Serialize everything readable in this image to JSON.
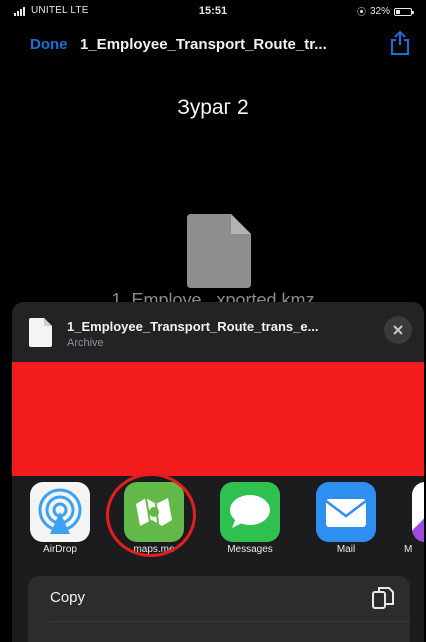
{
  "status_bar": {
    "carrier": "UNITEL  LTE",
    "time": "15:51",
    "battery_percent": "32%",
    "battery_level": 0.32
  },
  "nav_bar": {
    "done_label": "Done",
    "title": "1_Employee_Transport_Route_tr...",
    "share_icon": "share-icon"
  },
  "preview": {
    "heading": "Зураг 2",
    "file_icon": "file-icon",
    "file_name": "1_Employe...xported.kmz"
  },
  "share_sheet": {
    "file_name": "1_Employee_Transport_Route_trans_e...",
    "file_type": "Archive",
    "close_icon": "close-icon",
    "redacted_color": "#f31c1c",
    "apps": [
      {
        "label": "AirDrop",
        "icon": "airdrop-icon"
      },
      {
        "label": "maps.me",
        "icon": "maps-me-icon"
      },
      {
        "label": "Messages",
        "icon": "messages-icon"
      },
      {
        "label": "Mail",
        "icon": "mail-icon"
      },
      {
        "label": "M",
        "icon": "more-app-icon"
      }
    ],
    "highlight_color": "#e31e1e",
    "actions": [
      {
        "label": "Copy",
        "icon": "copy-icon"
      }
    ]
  },
  "colors": {
    "accent": "#1c6fd8",
    "sheet_background": "#1c1c1e",
    "maps_me_green": "#62b849",
    "messages_green": "#2fc14f",
    "mail_blue": "#2f8ff0"
  }
}
